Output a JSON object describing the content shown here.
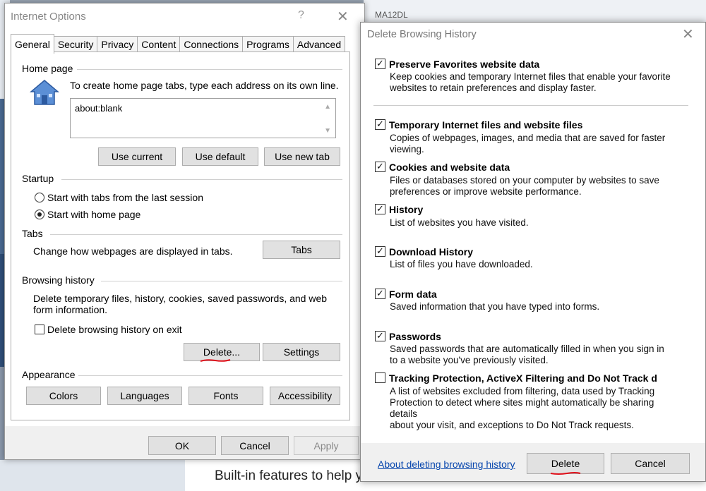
{
  "background": {
    "top_cut_text": "MA12DL",
    "bottom_text": "Built-in features to help y"
  },
  "internet_options": {
    "title": "Internet Options",
    "help_glyph": "?",
    "close_glyph": "✕",
    "tabs": [
      {
        "label": "General",
        "active": true
      },
      {
        "label": "Security",
        "active": false
      },
      {
        "label": "Privacy",
        "active": false
      },
      {
        "label": "Content",
        "active": false
      },
      {
        "label": "Connections",
        "active": false
      },
      {
        "label": "Programs",
        "active": false
      },
      {
        "label": "Advanced",
        "active": false
      }
    ],
    "home_page": {
      "label": "Home page",
      "instruction": "To create home page tabs, type each address on its own line.",
      "value": "about:blank",
      "buttons": {
        "use_current": "Use current",
        "use_default": "Use default",
        "use_new_tab": "Use new tab"
      }
    },
    "startup": {
      "label": "Startup",
      "option_last_session": "Start with tabs from the last session",
      "option_home_page": "Start with home page",
      "selected": "option_home_page"
    },
    "tabs_section": {
      "label": "Tabs",
      "description": "Change how webpages are displayed in tabs.",
      "button": "Tabs"
    },
    "browsing_history": {
      "label": "Browsing history",
      "description_line1": "Delete temporary files, history, cookies, saved passwords, and web",
      "description_line2": "form information.",
      "delete_on_exit_label": "Delete browsing history on exit",
      "delete_on_exit_checked": false,
      "delete_button": "Delete...",
      "settings_button": "Settings"
    },
    "appearance": {
      "label": "Appearance",
      "buttons": {
        "colors": "Colors",
        "languages": "Languages",
        "fonts": "Fonts",
        "accessibility": "Accessibility"
      }
    },
    "footer": {
      "ok": "OK",
      "cancel": "Cancel",
      "apply": "Apply"
    }
  },
  "delete_browsing_history": {
    "title": "Delete Browsing History",
    "close_glyph": "✕",
    "options": [
      {
        "title": "Preserve Favorites website data",
        "checked": true,
        "desc": [
          "Keep cookies and temporary Internet files that enable your favorite",
          "websites to retain preferences and display faster."
        ]
      },
      {
        "title": "Temporary Internet files and website files",
        "checked": true,
        "desc": [
          "Copies of webpages, images, and media that are saved for faster",
          "viewing."
        ]
      },
      {
        "title": "Cookies and website data",
        "checked": true,
        "desc": [
          "Files or databases stored on your computer by websites to save",
          "preferences or improve website performance."
        ]
      },
      {
        "title": "History",
        "checked": true,
        "desc": [
          "List of websites you have visited."
        ]
      },
      {
        "title": "Download History",
        "checked": true,
        "desc": [
          "List of files you have downloaded."
        ]
      },
      {
        "title": "Form data",
        "checked": true,
        "desc": [
          "Saved information that you have typed into forms."
        ]
      },
      {
        "title": "Passwords",
        "checked": true,
        "desc": [
          "Saved passwords that are automatically filled in when you sign in",
          "to a website you've previously visited."
        ]
      },
      {
        "title": "Tracking Protection, ActiveX Filtering and Do Not Track d",
        "checked": false,
        "desc": [
          "A list of websites excluded from filtering, data used by Tracking",
          "Protection to detect where sites might automatically be sharing details",
          "about your visit, and exceptions to Do Not Track requests."
        ]
      }
    ],
    "footer": {
      "about_link": "About deleting browsing history",
      "delete_button": "Delete",
      "cancel_button": "Cancel"
    },
    "check_glyph": "✓"
  },
  "colors": {
    "annotation_red": "#e0101a",
    "link_blue": "#0645ad"
  }
}
